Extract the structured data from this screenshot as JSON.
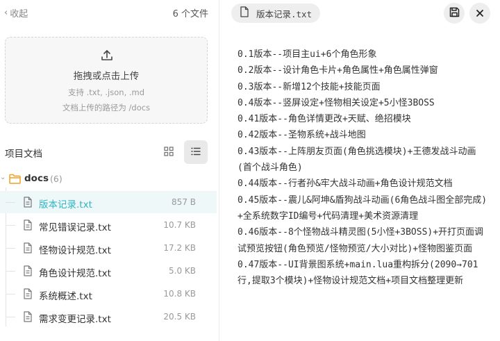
{
  "sidebar": {
    "collapse_label": "收起",
    "file_count": "6 个文件",
    "upload": {
      "title": "拖拽或点击上传",
      "hint_types": "支持 .txt, .json, .md",
      "hint_path": "文档上传的路径为 /docs"
    },
    "section_title": "项目文档",
    "folder": {
      "name": "docs",
      "count": "(6)",
      "files": [
        {
          "name": "版本记录.txt",
          "size": "857 B",
          "active": true
        },
        {
          "name": "常见错误记录.txt",
          "size": "10.7 KB"
        },
        {
          "name": "怪物设计规范.txt",
          "size": "17.2 KB"
        },
        {
          "name": "角色设计规范.txt",
          "size": "5.0 KB"
        },
        {
          "name": "系统概述.txt",
          "size": "10.8 KB"
        },
        {
          "name": "需求变更记录.txt",
          "size": "20.5 KB"
        }
      ]
    }
  },
  "editor": {
    "tab_title": "版本记录.txt",
    "lines": [
      "0.1版本--项目主ui+6个角色形象",
      "0.2版本--设计角色卡片+角色属性+角色属性弹窗",
      "0.3版本--新增12个技能+技能页面",
      "0.4版本--竖屏设定+怪物相关设定+5小怪3BOSS",
      "0.41版本--角色详情更改+天赋、绝招模块",
      "0.42版本--圣物系统+战斗地图",
      "0.43版本--上阵朋友页面(角色挑选模块)+王德发战斗动画(首个战斗角色)",
      "0.44版本--行者孙&牢大战斗动画+角色设计规范文档",
      "0.45版本--震儿&阿坤&盾狗战斗动画(6角色战斗图全部完成)+全系统数字ID编号+代码清理+美术资源清理",
      "0.46版本--8个怪物战斗精灵图(5小怪+3BOSS)+开打页面调试预览按钮(角色预览/怪物预览/大小对比)+怪物图鉴页面",
      "0.47版本--UI背景图系统+main.lua重构拆分(2090→701行,提取3个模块)+怪物设计规范文档+项目文档整理更新"
    ]
  },
  "colors": {
    "accent": "#2fb5c2",
    "folder_icon": "#f0a020",
    "active_row_bg": "#eef8f8"
  },
  "icons": [
    "chevron-left-icon",
    "upload-icon",
    "grid-view-icon",
    "list-view-icon",
    "folder-icon",
    "file-text-icon",
    "save-icon",
    "close-icon"
  ]
}
